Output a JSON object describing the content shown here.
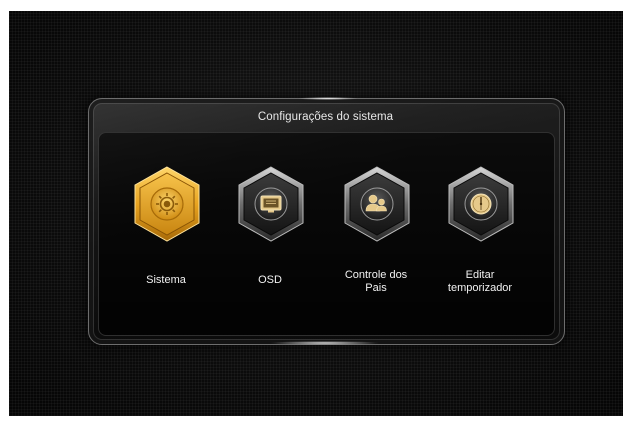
{
  "window": {
    "title": "Configurações do sistema"
  },
  "menu": {
    "items": [
      {
        "label": "Sistema",
        "icon": "gear-icon",
        "selected": true
      },
      {
        "label": "OSD",
        "icon": "monitor-icon",
        "selected": false
      },
      {
        "label": "Controle dos Pais",
        "icon": "parents-icon",
        "selected": false
      },
      {
        "label": "Editar temporizador",
        "icon": "clock-icon",
        "selected": false
      }
    ]
  },
  "colors": {
    "accent": "#f0b429",
    "accent_dark": "#b87a0c",
    "background": "#0c0c0c",
    "text": "#f2f2f2"
  }
}
